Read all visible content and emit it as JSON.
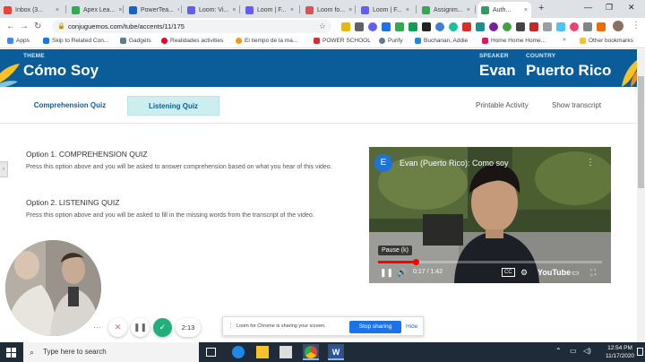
{
  "tabs": [
    {
      "label": "Inbox (3...",
      "color": "#ea4335"
    },
    {
      "label": "Apex Lea...",
      "color": "#34a853"
    },
    {
      "label": "PowerTea...",
      "color": "#1565c0"
    },
    {
      "label": "Loom: Vi...",
      "color": "#625df5"
    },
    {
      "label": "Loom | F...",
      "color": "#625df5"
    },
    {
      "label": "Loom fo...",
      "color": "#e05050"
    },
    {
      "label": "Loom | F...",
      "color": "#625df5"
    },
    {
      "label": "Assignm...",
      "color": "#34a853"
    },
    {
      "label": "Auth...",
      "color": "#2e9e5b"
    }
  ],
  "url": "conjuguemos.com/tube/accents/11/175",
  "bookmarks": [
    "Apps",
    "Skip to Related Con...",
    "Gadgets",
    "Realidades activities",
    "El tiempo de la ma...",
    "POWER SCHOOL",
    "Purify",
    "Buchanan, Addie",
    "Home Home Home...",
    "Other bookmarks"
  ],
  "banner": {
    "theme_label": "THEME",
    "theme_value": "Cómo Soy",
    "speaker_label": "SPEAKER",
    "speaker_value": "Evan",
    "country_label": "COUNTRY",
    "country_value": "Puerto Rico"
  },
  "subnav": {
    "comprehension": "Comprehension Quiz",
    "listening": "Listening Quiz",
    "printable": "Printable Activity",
    "transcript": "Show transcript"
  },
  "options": [
    {
      "title": "Option 1. COMPREHENSION QUIZ",
      "text": "Press this option above and you will be asked to answer comprehension based on what you hear of this video."
    },
    {
      "title": "Option 2. LISTENING QUIZ",
      "text": "Press this option above and you will be asked to fill in the missing words from the transcript of the video."
    }
  ],
  "video": {
    "avatar": "E",
    "title": "Evan (Puerto Rico): Como soy",
    "tooltip": "Pause (k)",
    "time": "0:17 / 1:42",
    "progress": 0.167,
    "brand": "YouTube"
  },
  "loom": {
    "timer": "2:13",
    "share_text": "Loom for Chrome is sharing your screen.",
    "stop": "Stop sharing",
    "hide": "Hide"
  },
  "taskbar": {
    "search_placeholder": "Type here to search",
    "time": "12:54 PM",
    "date": "11/17/2020"
  }
}
